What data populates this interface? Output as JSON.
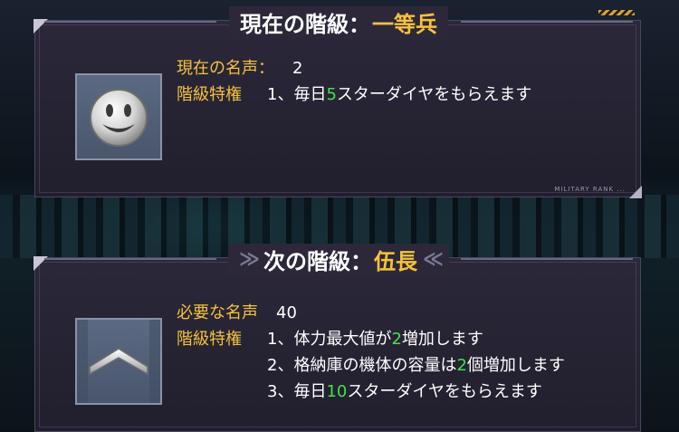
{
  "current": {
    "title_prefix": "現在の階級：",
    "rank": "一等兵",
    "fame_label": "現在の名声：",
    "fame_value": "2",
    "privilege_label": "階級特権",
    "privileges": [
      {
        "pre": "1、毎日",
        "num": "5",
        "post": "スターダイヤをもらえます"
      }
    ],
    "icon": "smiley-rank-icon",
    "tag": "MILITARY RANK ..."
  },
  "next": {
    "title_prefix": "次の階級：",
    "rank": "伍長",
    "chevrons_left": "≫",
    "chevrons_right": "≪",
    "fame_label": "必要な名声",
    "fame_value": "40",
    "privilege_label": "階級特権",
    "privileges": [
      {
        "pre": "1、体力最大値が",
        "num": "2",
        "post": "増加します"
      },
      {
        "pre": "2、格納庫の機体の容量は",
        "num": "2",
        "post": "個増加します"
      },
      {
        "pre": "3、毎日",
        "num": "10",
        "post": "スターダイヤをもらえます"
      }
    ],
    "icon": "chevron-rank-icon"
  },
  "colors": {
    "accent": "#f5c23a",
    "highlight": "#45e04a",
    "panel": "#2c283a"
  }
}
